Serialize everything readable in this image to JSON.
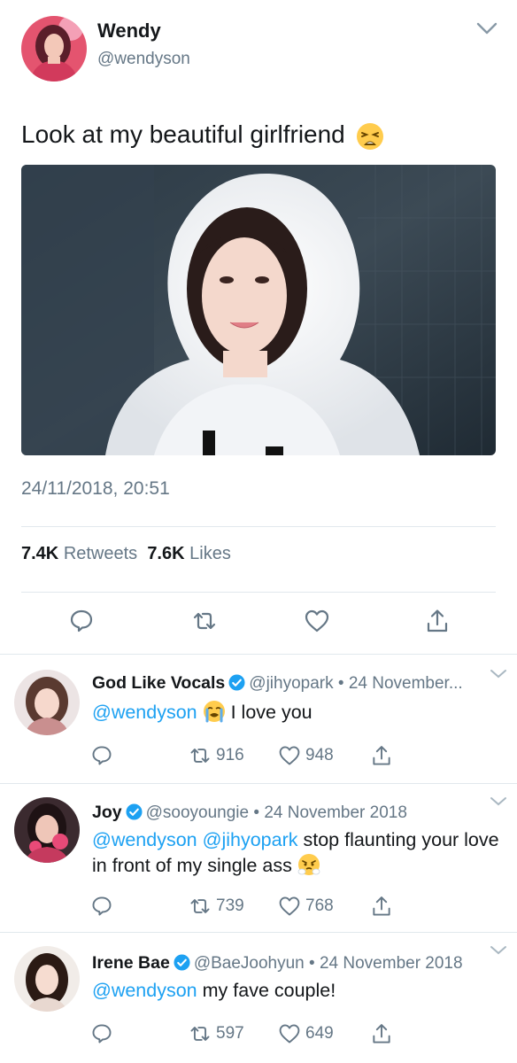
{
  "main_tweet": {
    "author_name": "Wendy",
    "author_handle": "@wendyson",
    "text": "Look at my beautiful girlfriend",
    "text_emoji": "weary-face-emoji",
    "timestamp": "24/11/2018, 20:51",
    "retweets_count": "7.4K",
    "retweets_label": "Retweets",
    "likes_count": "7.6K",
    "likes_label": "Likes"
  },
  "replies": [
    {
      "name": "God Like Vocals",
      "verified": true,
      "handle": "@jihyopark",
      "separator": "•",
      "date": "24 November...",
      "mentions": [
        "@wendyson"
      ],
      "text": "I love you",
      "emoji": "loudly-crying-face-emoji",
      "retweets": "916",
      "likes": "948"
    },
    {
      "name": "Joy",
      "verified": true,
      "handle": "@sooyoungie",
      "separator": "•",
      "date": "24 November 2018",
      "mentions": [
        "@wendyson",
        "@jihyopark"
      ],
      "text": "stop flaunting your love in front of my single ass",
      "emoji": "face-with-steam-emoji",
      "retweets": "739",
      "likes": "768"
    },
    {
      "name": "Irene Bae",
      "verified": true,
      "handle": "@BaeJoohyun",
      "separator": "•",
      "date": "24 November 2018",
      "mentions": [
        "@wendyson"
      ],
      "text": "my fave couple!",
      "retweets": "597",
      "likes": "649"
    }
  ],
  "colors": {
    "link_blue": "#1da1f2",
    "secondary_gray": "#657786",
    "divider": "#e1e8ed",
    "text_dark": "#14171a"
  }
}
